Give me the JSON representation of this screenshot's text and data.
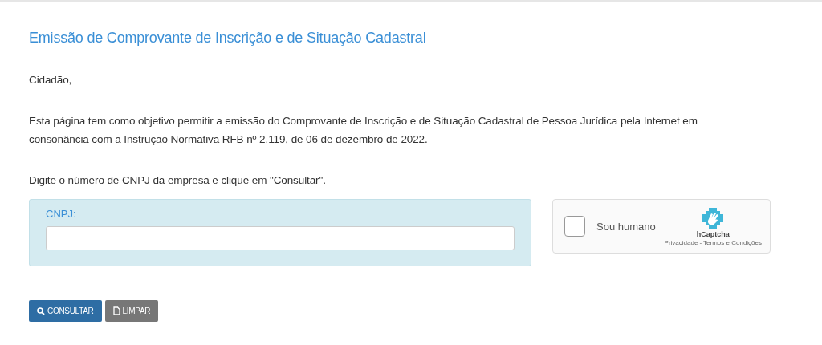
{
  "title": "Emissão de Comprovante de Inscrição e de Situação Cadastral",
  "greeting": "Cidadão,",
  "intro": {
    "text": "Esta página tem como objetivo permitir a emissão do Comprovante de Inscrição e de Situação Cadastral de Pessoa Jurídica pela Internet em consonância com a",
    "link": "Instrução Normativa RFB nº 2.119, de 06 de dezembro de 2022."
  },
  "instruction": "Digite o número de CNPJ da empresa e clique em \"Consultar\".",
  "cnpj_field": {
    "label": "CNPJ:"
  },
  "captcha": {
    "label": "Sou humano",
    "checked": false,
    "brand": "hCaptcha",
    "links": [
      "Privacidade",
      "Termos e Condições"
    ],
    "separator": "-"
  },
  "buttons": [
    {
      "kind": "search",
      "label": "CONSULTAR"
    },
    {
      "kind": "clear",
      "label": "LIMPAR"
    }
  ]
}
